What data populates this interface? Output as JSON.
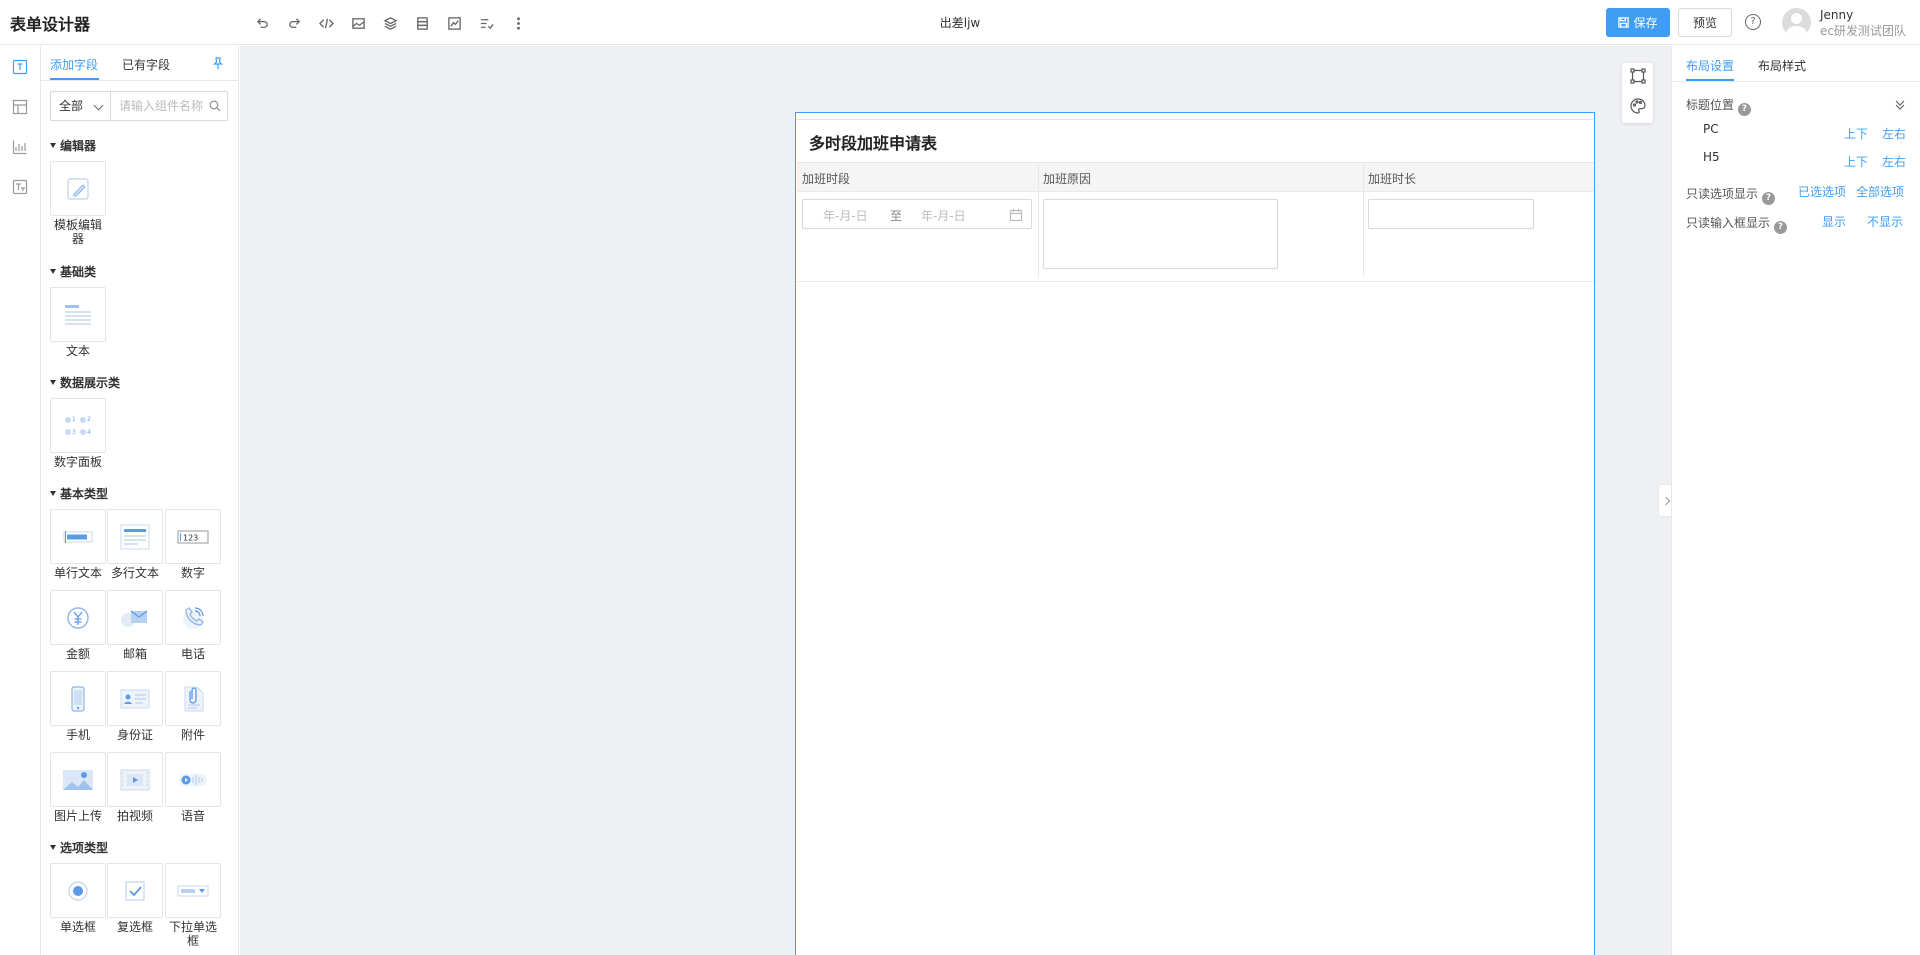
{
  "header": {
    "app_title": "表单设计器",
    "form_name": "出差ljw",
    "save_label": "保存",
    "preview_label": "预览",
    "help_label": "?",
    "user_name": "Jenny",
    "user_team": "ec研发测试团队",
    "toolbar_icons": [
      "undo-icon",
      "redo-icon",
      "code-icon",
      "image-icon",
      "layers-icon",
      "database-icon",
      "chart-icon",
      "checklist-icon",
      "more-vertical-icon"
    ]
  },
  "rail": {
    "items": [
      "form-fields-icon",
      "layout-icon",
      "chart-icon",
      "text-icon"
    ]
  },
  "panel": {
    "tab_add": "添加字段",
    "tab_existing": "已有字段",
    "filter_value": "全部",
    "search_placeholder": "请输入组件名称",
    "groups": {
      "editor": "编辑器",
      "basic": "基础类",
      "data_display": "数据展示类",
      "basic_types": "基本类型",
      "options": "选项类型"
    },
    "components": {
      "template_editor": "模板编辑器",
      "text": "文本",
      "number_panel": "数字面板",
      "single_line": "单行文本",
      "multi_line": "多行文本",
      "number": "数字",
      "amount": "金额",
      "email": "邮箱",
      "phone": "电话",
      "mobile": "手机",
      "id_card": "身份证",
      "attachment": "附件",
      "image_upload": "图片上传",
      "video": "拍视频",
      "voice": "语音",
      "radio": "单选框",
      "checkbox": "复选框",
      "dropdown_single": "下拉单选框"
    }
  },
  "canvas": {
    "form_title": "多时段加班申请表",
    "columns": [
      "加班时段",
      "加班原因",
      "加班时长"
    ],
    "date_start_placeholder": "年-月-日",
    "date_end_placeholder": "年-月-日",
    "date_separator": "至"
  },
  "right_panel": {
    "tab_layout": "布局设置",
    "tab_style": "布局样式",
    "title_position_label": "标题位置",
    "pc_label": "PC",
    "h5_label": "H5",
    "top_bottom": "上下",
    "left_right": "左右",
    "readonly_options_label": "只读选项显示",
    "selected_options": "已选选项",
    "all_options": "全部选项",
    "readonly_input_label": "只读输入框显示",
    "show": "显示",
    "hide": "不显示"
  },
  "colors": {
    "accent": "#3f9ef4",
    "canvas_bg": "#eef0f3"
  }
}
